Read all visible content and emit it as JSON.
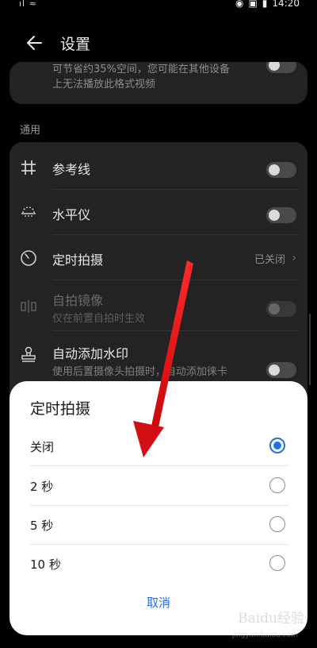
{
  "status_bar": {
    "left_text": "ıl ≈",
    "time": "14:20"
  },
  "header": {
    "title": "设置"
  },
  "top_card": {
    "desc_line1": "可节省约35%空间，您可能在其他设备",
    "desc_line2": "上无法播放此格式视频"
  },
  "section": {
    "label": "通用"
  },
  "settings": {
    "gridlines": {
      "label": "参考线"
    },
    "level": {
      "label": "水平仪"
    },
    "timer": {
      "label": "定时拍摄",
      "value": "已关闭"
    },
    "mirror": {
      "label": "自拍镜像",
      "sub": "仅在前置自拍时生效"
    },
    "watermark": {
      "label": "自动添加水印",
      "sub": "使用后置摄像头拍摄时，自动添加徕卡"
    }
  },
  "dialog": {
    "title": "定时拍摄",
    "options": [
      "关闭",
      "2 秒",
      "5 秒",
      "10 秒"
    ],
    "selected_index": 0,
    "cancel_label": "取消"
  },
  "watermark_brand": {
    "text": "Baidu经验",
    "sub": "jingyan.baidu.com"
  },
  "colors": {
    "accent": "#1f6ff2",
    "arrow": "#e0131a"
  }
}
